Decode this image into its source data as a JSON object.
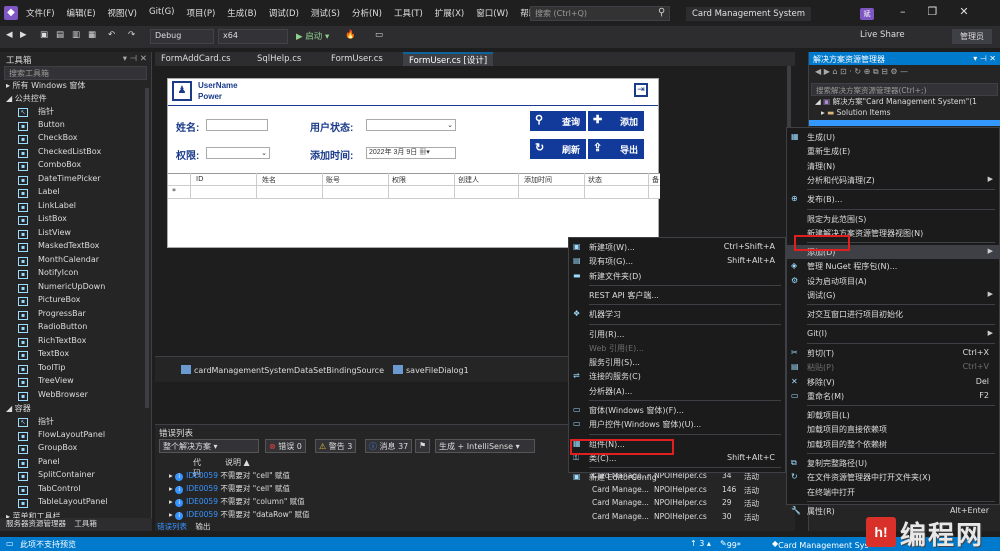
{
  "menubar": {
    "items": [
      "文件(F)",
      "编辑(E)",
      "视图(V)",
      "Git(G)",
      "项目(P)",
      "生成(B)",
      "调试(D)",
      "测试(S)",
      "分析(N)",
      "工具(T)",
      "扩展(X)",
      "窗口(W)",
      "帮助(H)"
    ],
    "search_placeholder": "搜索 (Ctrl+Q)",
    "app_title": "Card Management System",
    "avatar_text": "斌"
  },
  "toolbar": {
    "config": "Debug",
    "platform": "x64",
    "start_label": "▶ 启动 ▾",
    "live_share": "Live Share",
    "admin": "管理员"
  },
  "toolbox": {
    "title": "工具箱",
    "search_placeholder": "搜索工具箱",
    "cat_all": "▸ 所有 Windows 窗体",
    "cat_common": "◢ 公共控件",
    "items": [
      "指针",
      "Button",
      "CheckBox",
      "CheckedListBox",
      "ComboBox",
      "DateTimePicker",
      "Label",
      "LinkLabel",
      "ListBox",
      "ListView",
      "MaskedTextBox",
      "MonthCalendar",
      "NotifyIcon",
      "NumericUpDown",
      "PictureBox",
      "ProgressBar",
      "RadioButton",
      "RichTextBox",
      "TextBox",
      "ToolTip",
      "TreeView",
      "WebBrowser"
    ],
    "cat_container": "◢ 容器",
    "container_items": [
      "指针",
      "FlowLayoutPanel",
      "GroupBox",
      "Panel",
      "SplitContainer",
      "TabControl",
      "TableLayoutPanel"
    ],
    "cat_menu": "▸ 菜单和工具栏",
    "bottom_tabs": [
      "服务器资源管理器",
      "工具箱"
    ]
  },
  "doc_tabs": [
    "FormAddCard.cs",
    "SqlHelp.cs",
    "FormUser.cs",
    "FormUser.cs [设计]"
  ],
  "form": {
    "username": "UserName",
    "power": "Power",
    "name_label": "姓名:",
    "status_label": "用户状态:",
    "auth_label": "权限:",
    "time_label": "添加时间:",
    "date_value": "2022年 3月 9日",
    "btn_query": "查询",
    "btn_add": "添加",
    "btn_refresh": "刷新",
    "btn_export": "导出",
    "grid_columns": [
      "ID",
      "姓名",
      "账号",
      "权限",
      "创建人",
      "添加时间",
      "状态",
      "备"
    ],
    "new_row_marker": "*"
  },
  "tray": {
    "binding_source": "cardManagementSystemDataSetBindingSource",
    "save_dialog": "saveFileDialog1"
  },
  "errors": {
    "title": "错误列表",
    "scope": "整个解决方案",
    "errors_count": "错误 0",
    "warnings_count": "警告 3",
    "messages_count": "消息 37",
    "build_filter": "生成 + IntelliSense",
    "col_code": "代码",
    "col_desc": "说明 ▲",
    "rows": [
      {
        "code": "IDE0059",
        "desc": "不需要对 \"cell\" 赋值"
      },
      {
        "code": "IDE0059",
        "desc": "不需要对 \"cell\" 赋值"
      },
      {
        "code": "IDE0059",
        "desc": "不需要对 \"column\" 赋值"
      },
      {
        "code": "IDE0059",
        "desc": "不需要对 \"dataRow\" 赋值"
      }
    ],
    "bottom_tabs": [
      "错误列表",
      "输出"
    ]
  },
  "solution": {
    "title": "解决方案资源管理器",
    "search_placeholder": "搜索解决方案资源管理器(Ctrl+;)",
    "root": "解决方案\"Card Management System\"(1",
    "items_folder": "Solution Items"
  },
  "ctx_main": [
    {
      "label": "生成(U)",
      "shortcut": ""
    },
    {
      "label": "重新生成(E)",
      "shortcut": ""
    },
    {
      "label": "清理(N)",
      "shortcut": ""
    },
    {
      "label": "分析和代码清理(Z)",
      "shortcut": "",
      "sub": true
    },
    {
      "label": "发布(B)...",
      "shortcut": ""
    },
    {
      "label": "限定为此范围(S)",
      "shortcut": ""
    },
    {
      "label": "新建解决方案资源管理器视图(N)",
      "shortcut": ""
    },
    {
      "label": "添加(D)",
      "shortcut": "",
      "sub": true
    },
    {
      "label": "管理 NuGet 程序包(N)...",
      "shortcut": ""
    },
    {
      "label": "设为启动项目(A)",
      "shortcut": ""
    },
    {
      "label": "调试(G)",
      "shortcut": "",
      "sub": true
    },
    {
      "label": "对交互窗口进行项目初始化",
      "shortcut": ""
    },
    {
      "label": "Git(I)",
      "shortcut": "",
      "sub": true
    },
    {
      "label": "剪切(T)",
      "shortcut": "Ctrl+X"
    },
    {
      "label": "粘贴(P)",
      "shortcut": "Ctrl+V",
      "disabled": true
    },
    {
      "label": "移除(V)",
      "shortcut": "Del"
    },
    {
      "label": "重命名(M)",
      "shortcut": "F2"
    },
    {
      "label": "卸载项目(L)",
      "shortcut": ""
    },
    {
      "label": "加载项目的直接依赖项",
      "shortcut": ""
    },
    {
      "label": "加载项目的整个依赖树",
      "shortcut": ""
    },
    {
      "label": "复制完整路径(U)",
      "shortcut": ""
    },
    {
      "label": "在文件资源管理器中打开文件夹(X)",
      "shortcut": ""
    },
    {
      "label": "在终端中打开",
      "shortcut": ""
    },
    {
      "label": "属性(R)",
      "shortcut": "Alt+Enter"
    }
  ],
  "ctx_add": [
    {
      "label": "新建项(W)...",
      "shortcut": "Ctrl+Shift+A"
    },
    {
      "label": "现有项(G)...",
      "shortcut": "Shift+Alt+A"
    },
    {
      "label": "新建文件夹(D)",
      "shortcut": ""
    },
    {
      "label": "REST API 客户端...",
      "shortcut": ""
    },
    {
      "label": "机器学习",
      "shortcut": ""
    },
    {
      "label": "引用(R)...",
      "shortcut": ""
    },
    {
      "label": "Web 引用(E)...",
      "shortcut": "",
      "disabled": true
    },
    {
      "label": "服务引用(S)...",
      "shortcut": ""
    },
    {
      "label": "连接的服务(C)",
      "shortcut": ""
    },
    {
      "label": "分析器(A)...",
      "shortcut": ""
    },
    {
      "label": "窗体(Windows 窗体)(F)...",
      "shortcut": ""
    },
    {
      "label": "用户控件(Windows 窗体)(U)...",
      "shortcut": ""
    },
    {
      "label": "组件(N)...",
      "shortcut": ""
    },
    {
      "label": "类(C)...",
      "shortcut": "Shift+Alt+C"
    },
    {
      "label": "新建 EditorConfig",
      "shortcut": ""
    }
  ],
  "peek_rows": [
    {
      "proj": "Card Manage...",
      "file": "NPOIHelper.cs",
      "line": "34",
      "state": "活动"
    },
    {
      "proj": "Card Manage...",
      "file": "NPOIHelper.cs",
      "line": "146",
      "state": "活动"
    },
    {
      "proj": "Card Manage...",
      "file": "NPOIHelper.cs",
      "line": "29",
      "state": "活动"
    },
    {
      "proj": "Card Manage...",
      "file": "NPOIHelper.cs",
      "line": "30",
      "state": "活动"
    }
  ],
  "status": {
    "left": "此项不支持预览",
    "arrows": "↑ 3 ▴",
    "pct": "99*",
    "repo": "Card Management Sys"
  },
  "watermark": {
    "logo": "h!",
    "text": "编程网"
  },
  "colors": {
    "accent": "#007acc",
    "form_blue": "#123a9a",
    "highlight_red": "#e02020"
  }
}
